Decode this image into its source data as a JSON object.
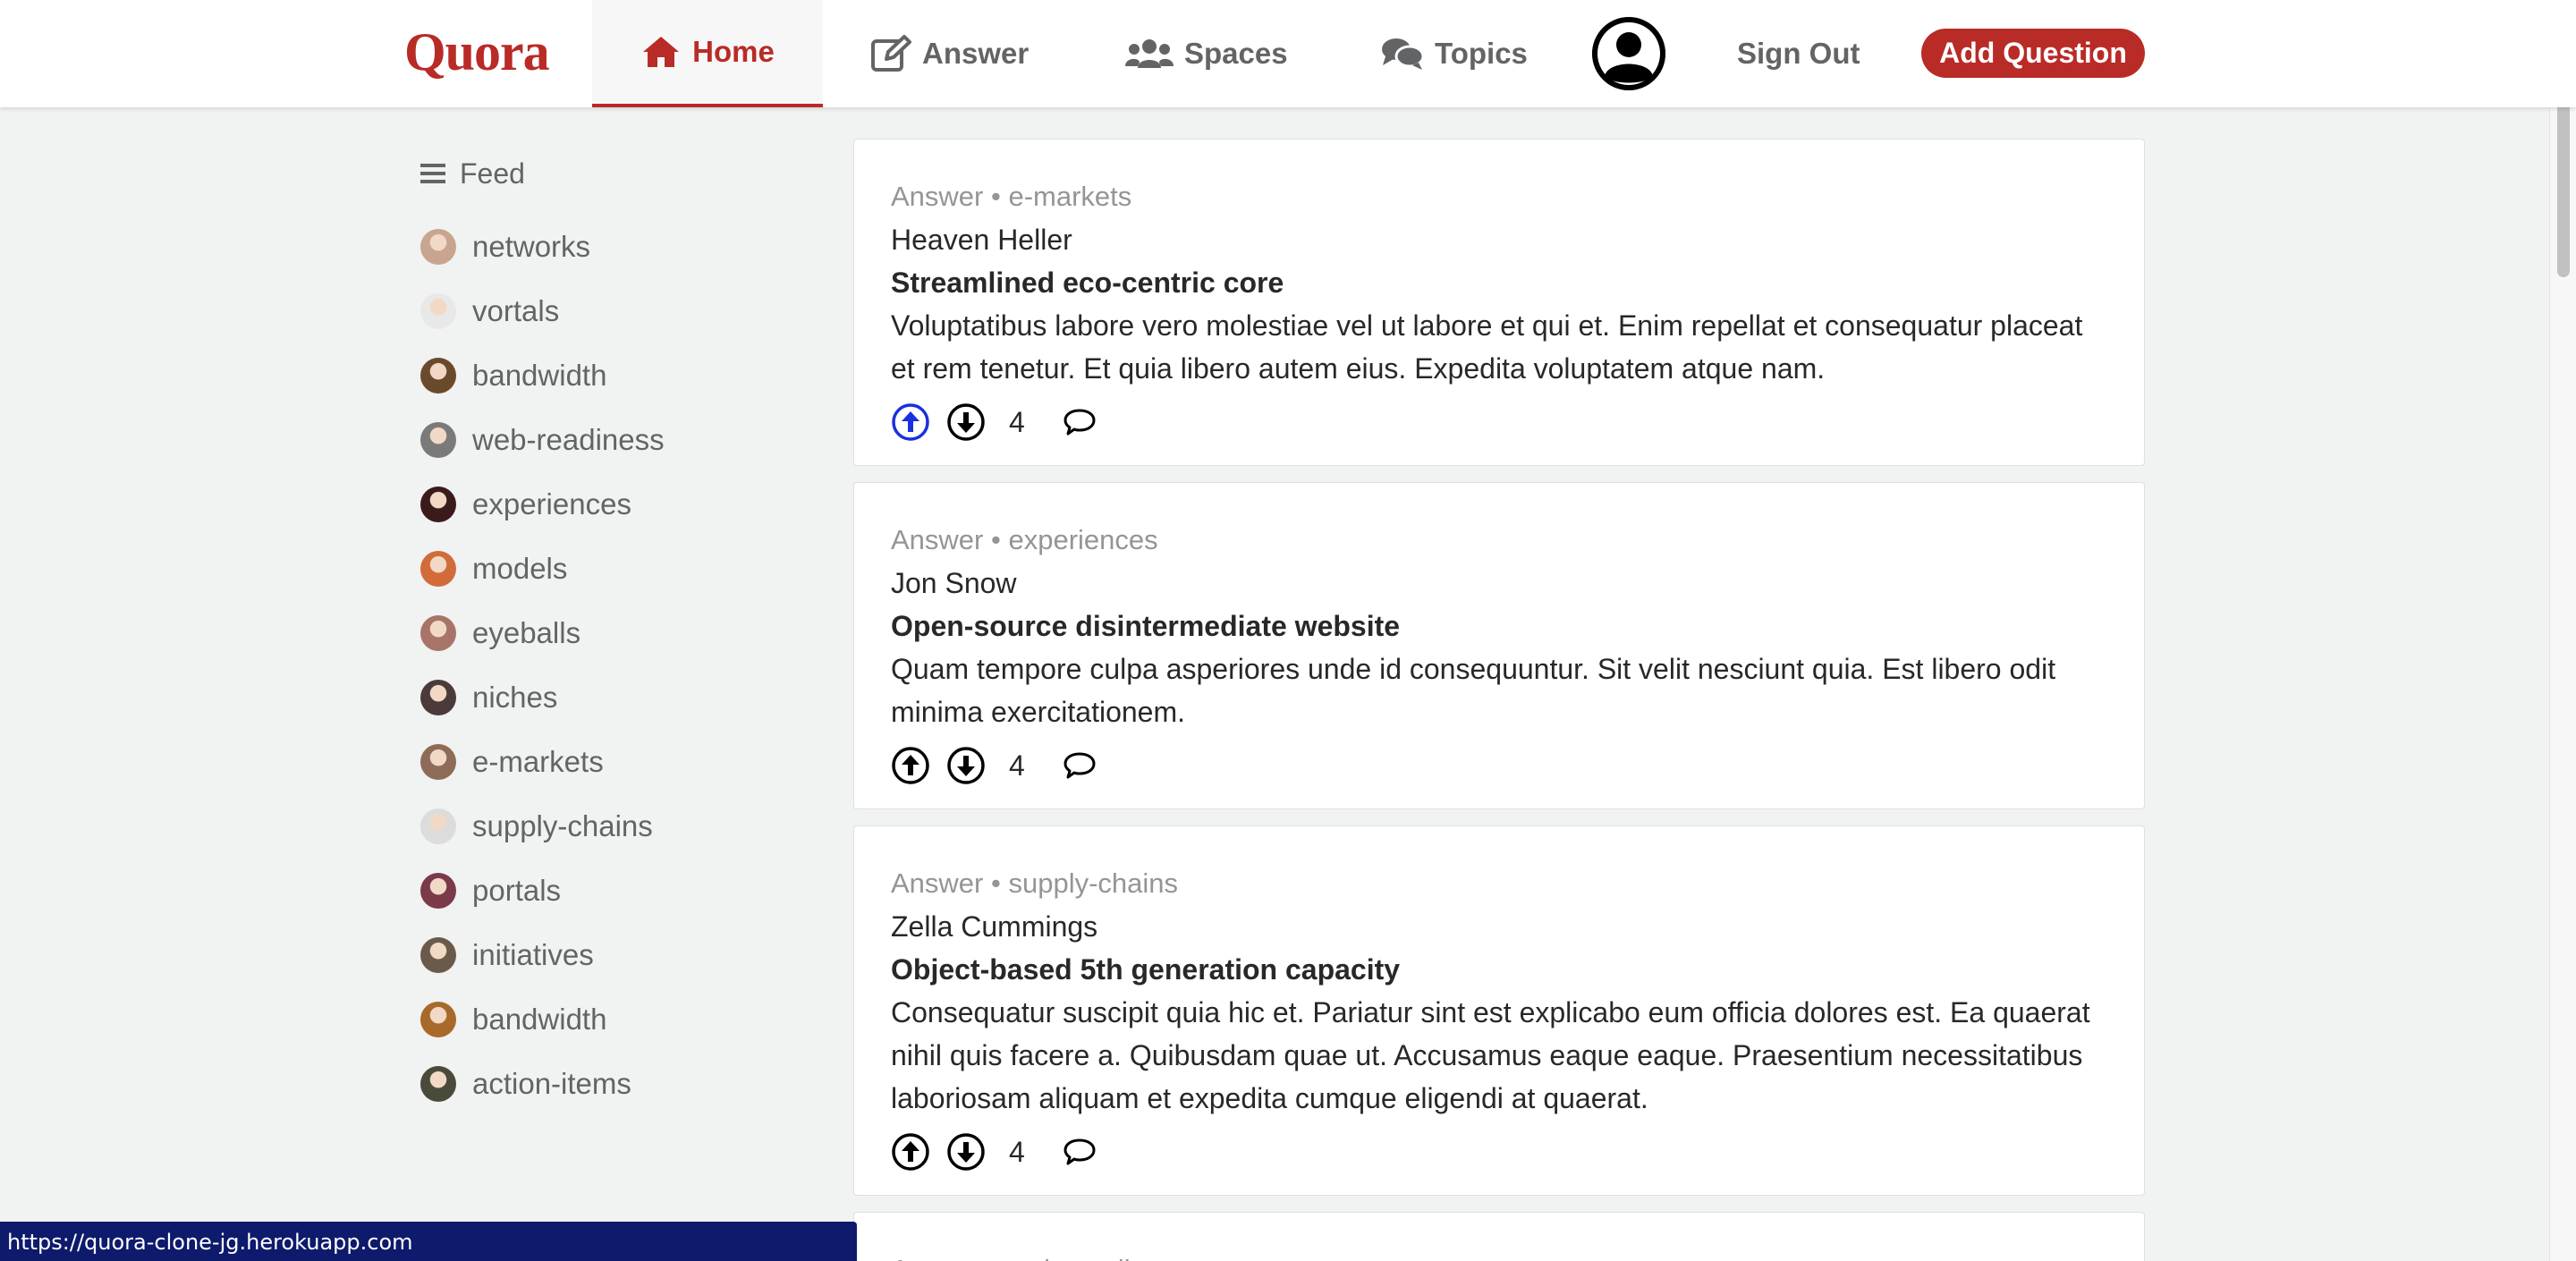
{
  "nav": {
    "logo": "Quora",
    "home": "Home",
    "answer": "Answer",
    "spaces": "Spaces",
    "topics": "Topics",
    "sign_out": "Sign Out",
    "add_question": "Add Question",
    "active_color": "#b92b27"
  },
  "sidebar": {
    "feed_label": "Feed",
    "items": [
      {
        "label": "networks",
        "avatar_color": "#c9a58f"
      },
      {
        "label": "vortals",
        "avatar_color": "#e8e8e8"
      },
      {
        "label": "bandwidth",
        "avatar_color": "#6b4a2b"
      },
      {
        "label": "web-readiness",
        "avatar_color": "#7a7a7a"
      },
      {
        "label": "experiences",
        "avatar_color": "#3a1a1a"
      },
      {
        "label": "models",
        "avatar_color": "#d26b3a"
      },
      {
        "label": "eyeballs",
        "avatar_color": "#a8746a"
      },
      {
        "label": "niches",
        "avatar_color": "#4a3a3a"
      },
      {
        "label": "e-markets",
        "avatar_color": "#8e6b58"
      },
      {
        "label": "supply-chains",
        "avatar_color": "#dcdcdc"
      },
      {
        "label": "portals",
        "avatar_color": "#7a3a4a"
      },
      {
        "label": "initiatives",
        "avatar_color": "#6b5a4a"
      },
      {
        "label": "bandwidth",
        "avatar_color": "#a86a2a"
      },
      {
        "label": "action-items",
        "avatar_color": "#4a4a3a"
      }
    ]
  },
  "feed": {
    "cards": [
      {
        "type": "Answer",
        "topic": "e-markets",
        "author": "Heaven Heller",
        "title": "Streamlined eco-centric core",
        "body": "Voluptatibus labore vero molestiae vel ut labore et qui et. Enim repellat et consequatur placeat et rem tenetur. Et quia libero autem eius. Expedita voluptatem atque nam.",
        "votes": "4",
        "upvoted": true
      },
      {
        "type": "Answer",
        "topic": "experiences",
        "author": "Jon Snow",
        "title": "Open-source disintermediate website",
        "body": "Quam tempore culpa asperiores unde id consequuntur. Sit velit nesciunt quia. Est libero odit minima exercitationem.",
        "votes": "4",
        "upvoted": false
      },
      {
        "type": "Answer",
        "topic": "supply-chains",
        "author": "Zella Cummings",
        "title": "Object-based 5th generation capacity",
        "body": "Consequatur suscipit quia hic et. Pariatur sint est explicabo eum officia dolores est. Ea quaerat nihil quis facere a. Quibusdam quae ut. Accusamus eaque eaque. Praesentium necessitatibus laboriosam aliquam et expedita cumque eligendi at quaerat.",
        "votes": "4",
        "upvoted": false
      },
      {
        "type": "Answer",
        "topic": "web-readiness",
        "partial": true
      }
    ]
  },
  "status_url": "https://quora-clone-jg.herokuapp.com",
  "upvote_active_color": "#1a2fe0"
}
